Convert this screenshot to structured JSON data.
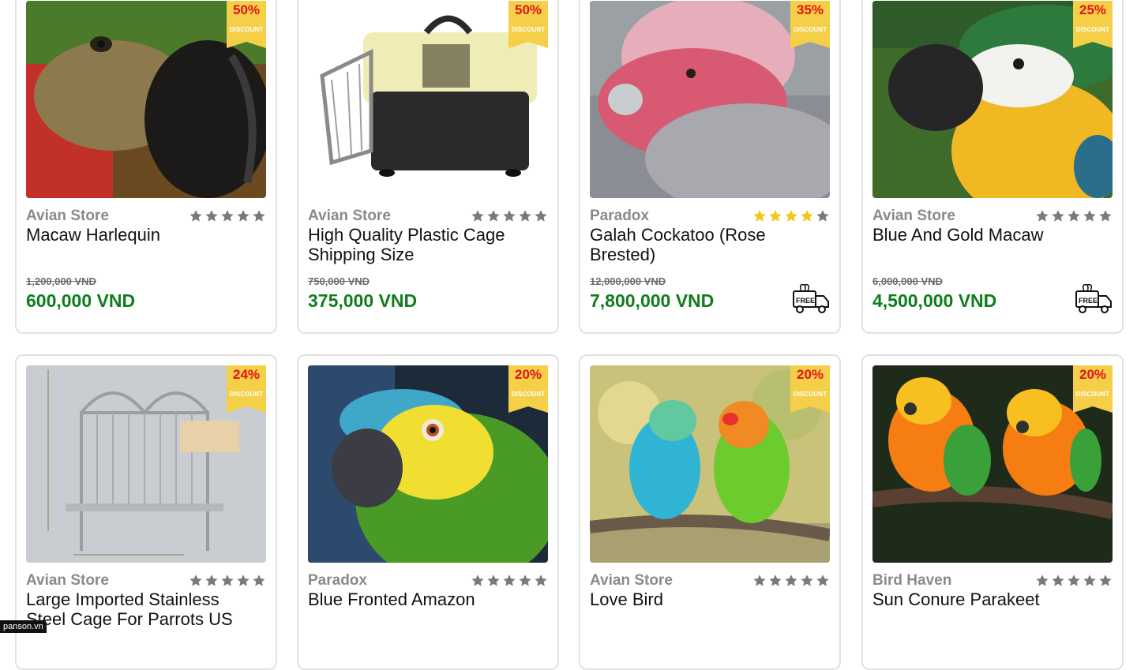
{
  "discount_label": "DISCOUNT",
  "colors": {
    "price_green": "#0f7d1e",
    "discount_red": "#e3121b",
    "ribbon_yellow": "#f5cf47",
    "star_gold": "#f5c518",
    "star_gray": "#7a7a7a"
  },
  "products": [
    {
      "store": "Avian Store",
      "name": "Macaw Harlequin",
      "old_price": "1,200,000 VND",
      "price": "600,000 VND",
      "discount": "50%",
      "rating": 0,
      "free_shipping": false,
      "image": "harlequin-macaw-photo"
    },
    {
      "store": "Avian Store",
      "name": "High Quality Plastic Cage Shipping Size",
      "old_price": "750,000 VND",
      "price": "375,000 VND",
      "discount": "50%",
      "rating": 0,
      "free_shipping": false,
      "image": "plastic-pet-carrier-photo"
    },
    {
      "store": "Paradox",
      "name": "Galah Cockatoo (Rose Brested)",
      "old_price": "12,000,000 VND",
      "price": "7,800,000 VND",
      "discount": "35%",
      "rating": 4,
      "free_shipping": true,
      "image": "galah-cockatoo-photo"
    },
    {
      "store": "Avian Store",
      "name": "Blue And Gold Macaw",
      "old_price": "6,000,000 VND",
      "price": "4,500,000 VND",
      "discount": "25%",
      "rating": 0,
      "free_shipping": true,
      "image": "blue-gold-macaw-photo"
    },
    {
      "store": "Avian Store",
      "name": "Large Imported Stainless Steel Cage For Parrots US",
      "old_price": "",
      "price": "",
      "discount": "24%",
      "rating": 0,
      "free_shipping": false,
      "image": "stainless-parrot-cage-photo"
    },
    {
      "store": "Paradox",
      "name": "Blue Fronted Amazon",
      "old_price": "",
      "price": "",
      "discount": "20%",
      "rating": 0,
      "free_shipping": false,
      "image": "blue-fronted-amazon-photo"
    },
    {
      "store": "Avian Store",
      "name": "Love Bird",
      "old_price": "",
      "price": "",
      "discount": "20%",
      "rating": 0,
      "free_shipping": false,
      "image": "lovebirds-photo"
    },
    {
      "store": "Bird Haven",
      "name": "Sun Conure Parakeet",
      "old_price": "",
      "price": "",
      "discount": "20%",
      "rating": 0,
      "free_shipping": false,
      "image": "sun-conure-photo"
    }
  ],
  "free_shipping_label": "FREE",
  "corner_badge": "panson.vn"
}
